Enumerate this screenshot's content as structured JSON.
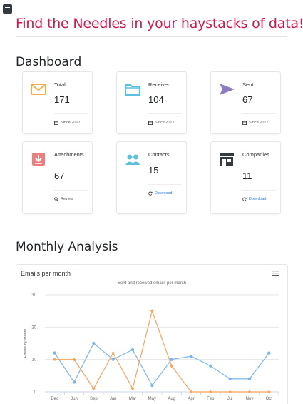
{
  "hero": {
    "title": "Find the Needles in your haystacks of data!"
  },
  "dashboard": {
    "heading": "Dashboard",
    "cards": [
      {
        "label": "Total",
        "value": "171",
        "footer": "Since 2017",
        "icon": "mail-icon",
        "color": "#f0ad4e"
      },
      {
        "label": "Received",
        "value": "104",
        "footer": "Since 2017",
        "icon": "folder-icon",
        "color": "#5bc0de"
      },
      {
        "label": "Sent",
        "value": "67",
        "footer": "Since 2017",
        "icon": "send-icon",
        "color": "#8e7cc3"
      },
      {
        "label": "Attachments",
        "value": "67",
        "footer": "Review",
        "icon": "download-box-icon",
        "color": "#f27c7c"
      },
      {
        "label": "Contacts",
        "value": "15",
        "footer": "Download",
        "icon": "users-icon",
        "color": "#5bc0de"
      },
      {
        "label": "Companies",
        "value": "11",
        "footer": "Download",
        "icon": "store-icon",
        "color": "#343a40"
      }
    ]
  },
  "analysis": {
    "heading": "Monthly Analysis",
    "card_title": "Emails per month",
    "menu_icon": "hamburger-icon"
  },
  "chart_data": {
    "type": "line",
    "title": "Sent and received emails per month",
    "xlabel": "",
    "ylabel": "Emails by Month",
    "categories": [
      "Dec",
      "Jun",
      "Sep",
      "Jan",
      "Mar",
      "May",
      "Aug",
      "Apr",
      "Feb",
      "Jul",
      "Nov",
      "Oct"
    ],
    "ylim": [
      0,
      30
    ],
    "yticks": [
      0,
      10,
      20,
      30
    ],
    "grid": true,
    "series": [
      {
        "color": "#7cb5ec",
        "values": [
          12,
          3,
          15,
          10,
          13,
          2,
          10,
          11,
          8,
          4,
          4,
          12
        ]
      },
      {
        "color": "#f7a35c",
        "values": [
          10,
          10,
          1,
          12,
          1,
          25,
          8,
          0,
          0,
          0,
          0,
          0
        ]
      }
    ]
  }
}
